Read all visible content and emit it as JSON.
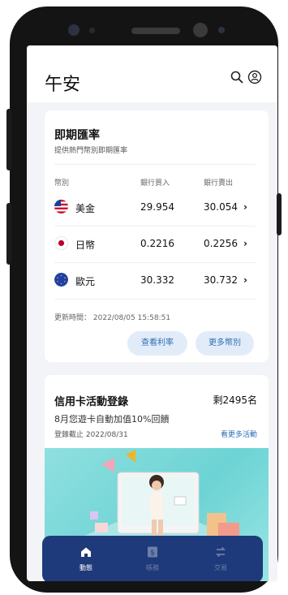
{
  "header": {
    "greeting": "午安",
    "icons": [
      "search-icon",
      "user-icon"
    ]
  },
  "rate_card": {
    "title": "即期匯率",
    "subtitle": "提供熱門幣別即期匯率",
    "columns": [
      "幣別",
      "銀行買入",
      "銀行賣出"
    ],
    "rows": [
      {
        "currency": "美金",
        "buy": "29.954",
        "sell": "30.054",
        "flag": "us-flag-icon"
      },
      {
        "currency": "日幣",
        "buy": "0.2216",
        "sell": "0.2256",
        "flag": "jp-flag-icon"
      },
      {
        "currency": "歐元",
        "buy": "30.332",
        "sell": "30.732",
        "flag": "eu-flag-icon"
      }
    ],
    "chevron": "›",
    "updated_label": "更新時間：",
    "updated_value": "2022/08/05 15:58:51",
    "view_rates_button": "查看利率",
    "more_currency_button": "更多幣別"
  },
  "promo_card": {
    "title": "信用卡活動登錄",
    "remaining": "剩2495名",
    "description": "8月您遊卡自動加值10%回饋",
    "deadline": "登錄截止 2022/08/31",
    "more_link": "看更多活動"
  },
  "bottom_nav": {
    "items": [
      {
        "label": "動態",
        "icon": "home-icon",
        "active": true
      },
      {
        "label": "帳務",
        "icon": "bill-icon",
        "active": false
      },
      {
        "label": "交易",
        "icon": "transfer-icon",
        "active": false
      }
    ]
  },
  "colors": {
    "accent": "#2d6fb7",
    "nav_bg": "#1f3a7a",
    "pill_bg": "#e2ecf8"
  }
}
